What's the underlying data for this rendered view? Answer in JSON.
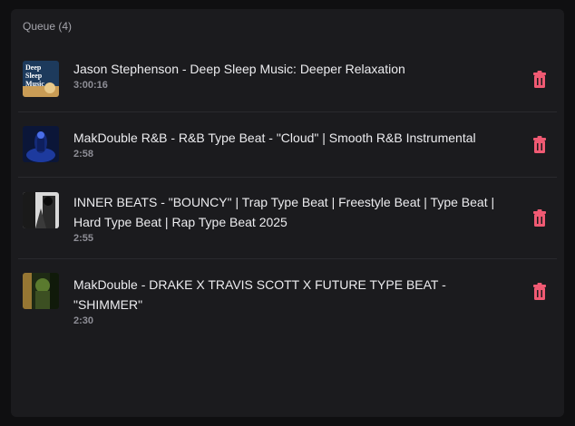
{
  "queue": {
    "title": "Queue (4)",
    "items": [
      {
        "title": "Jason Stephenson - Deep Sleep Music: Deeper Relaxation",
        "duration": "3:00:16",
        "thumb_text": "Deep Sleep Music",
        "thumb_colors": [
          "#16324f",
          "#e0b86a"
        ]
      },
      {
        "title": "MakDouble R&B - R&B Type Beat - \"Cloud\" | Smooth R&B Instrumental",
        "duration": "2:58",
        "thumb_colors": [
          "#0a1840",
          "#3a5bd8"
        ]
      },
      {
        "title": "INNER BEATS - \"BOUNCY\" | Trap Type Beat | Freestyle Beat | Type Beat | Hard Type Beat | Rap Type Beat 2025",
        "duration": "2:55",
        "thumb_colors": [
          "#111111",
          "#d8d8d8"
        ]
      },
      {
        "title": "MakDouble - DRAKE X TRAVIS SCOTT X FUTURE TYPE BEAT - \"SHIMMER\"",
        "duration": "2:30",
        "thumb_colors": [
          "#2c3a1c",
          "#6f8a3a"
        ]
      }
    ]
  },
  "colors": {
    "delete_icon": "#f05a73"
  }
}
